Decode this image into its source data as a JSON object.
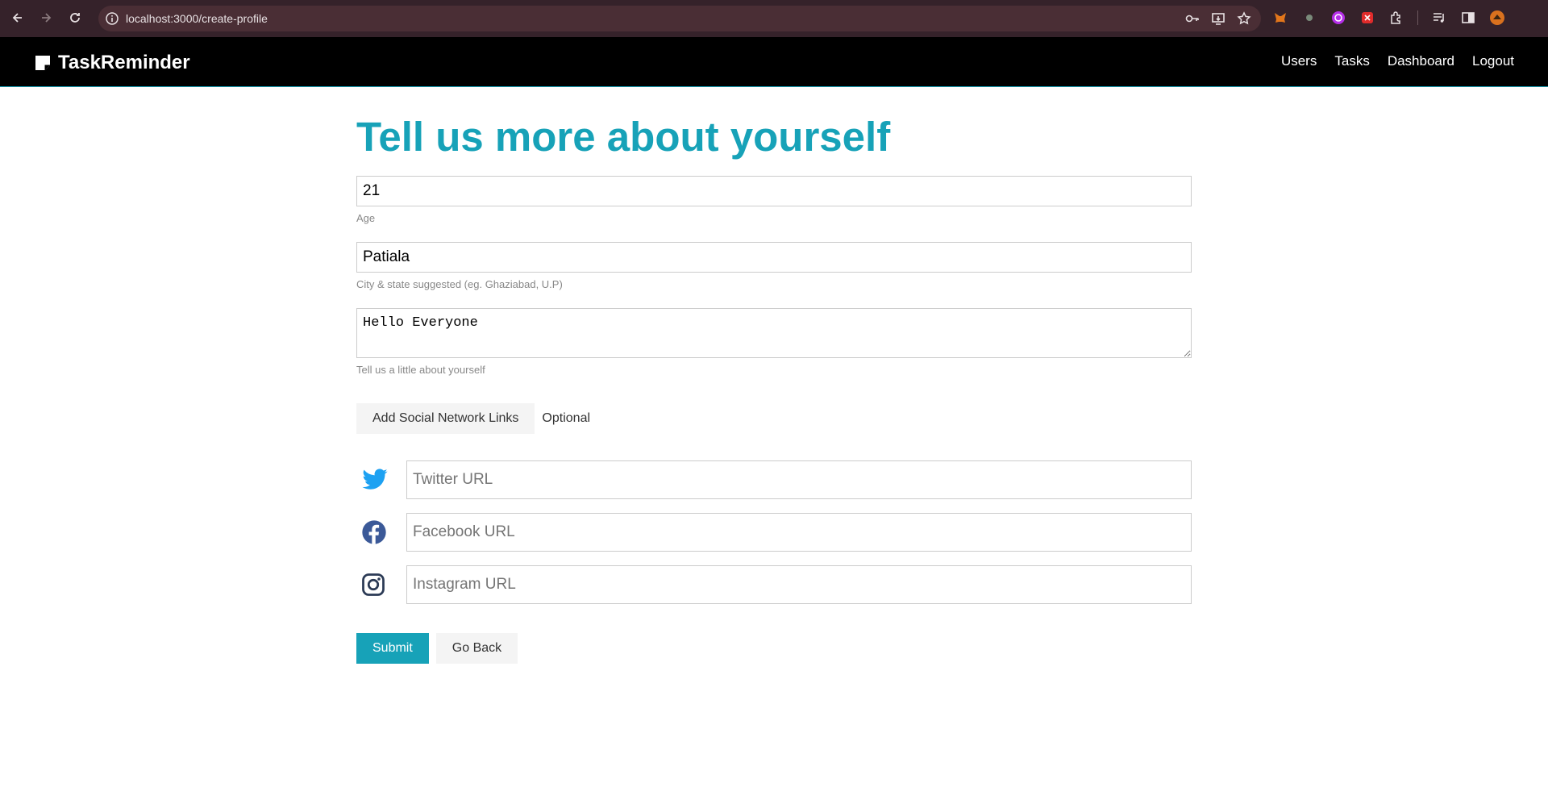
{
  "browser": {
    "url": "localhost:3000/create-profile"
  },
  "navbar": {
    "brand": "TaskReminder",
    "links": [
      "Users",
      "Tasks",
      "Dashboard",
      "Logout"
    ]
  },
  "form": {
    "title": "Tell us more about yourself",
    "age": {
      "value": "21",
      "hint": "Age"
    },
    "location": {
      "value": "Patiala",
      "hint": "City & state suggested (eg. Ghaziabad, U.P)"
    },
    "bio": {
      "value": "Hello Everyone",
      "hint": "Tell us a little about yourself"
    },
    "social_toggle_label": "Add Social Network Links",
    "optional_label": "Optional",
    "social": {
      "twitter_placeholder": "Twitter URL",
      "facebook_placeholder": "Facebook URL",
      "instagram_placeholder": "Instagram URL"
    },
    "submit_label": "Submit",
    "back_label": "Go Back"
  },
  "colors": {
    "accent": "#17a2b8",
    "twitter": "#1da1f2",
    "facebook": "#3b5998",
    "instagram": "#2b3a55"
  }
}
